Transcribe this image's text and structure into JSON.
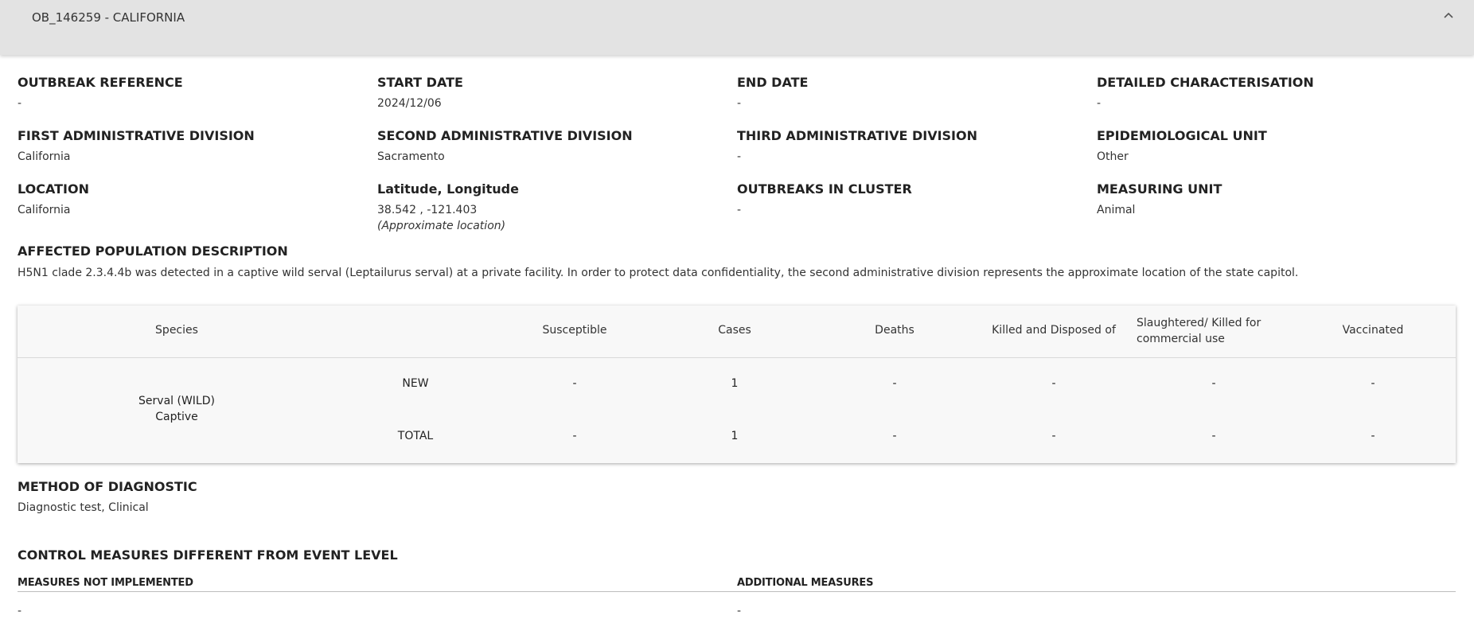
{
  "header": {
    "title": "OB_146259 - CALIFORNIA"
  },
  "fields": {
    "outbreak_reference": {
      "label": "OUTBREAK REFERENCE",
      "value": "-"
    },
    "start_date": {
      "label": "START DATE",
      "value": "2024/12/06"
    },
    "end_date": {
      "label": "END DATE",
      "value": "-"
    },
    "detailed_characterisation": {
      "label": "DETAILED CHARACTERISATION",
      "value": "-"
    },
    "first_admin_division": {
      "label": "FIRST ADMINISTRATIVE DIVISION",
      "value": "California"
    },
    "second_admin_division": {
      "label": "SECOND ADMINISTRATIVE DIVISION",
      "value": "Sacramento"
    },
    "third_admin_division": {
      "label": "THIRD ADMINISTRATIVE DIVISION",
      "value": "-"
    },
    "epidemiological_unit": {
      "label": "EPIDEMIOLOGICAL UNIT",
      "value": "Other"
    },
    "location": {
      "label": "LOCATION",
      "value": "California"
    },
    "lat_long": {
      "label": "Latitude, Longitude",
      "value": "38.542 , -121.403",
      "note": "(Approximate location)"
    },
    "outbreaks_in_cluster": {
      "label": "OUTBREAKS IN CLUSTER",
      "value": "-"
    },
    "measuring_unit": {
      "label": "MEASURING UNIT",
      "value": "Animal"
    }
  },
  "affected_population": {
    "label": "AFFECTED POPULATION DESCRIPTION",
    "text": "H5N1 clade 2.3.4.4b was detected in a captive wild serval (Leptailurus serval) at a private facility. In order to protect data confidentiality, the second administrative division represents the approximate location of the state capitol."
  },
  "table": {
    "headers": {
      "species": "Species",
      "susceptible": "Susceptible",
      "cases": "Cases",
      "deaths": "Deaths",
      "killed_disposed": "Killed and Disposed of",
      "slaughtered": "Slaughtered/ Killed for commercial use",
      "vaccinated": "Vaccinated"
    },
    "species_line1": "Serval (WILD)",
    "species_line2": "Captive",
    "rows": [
      {
        "type": "NEW",
        "susceptible": "-",
        "cases": "1",
        "deaths": "-",
        "killed_disposed": "-",
        "slaughtered": "-",
        "vaccinated": "-"
      },
      {
        "type": "TOTAL",
        "susceptible": "-",
        "cases": "1",
        "deaths": "-",
        "killed_disposed": "-",
        "slaughtered": "-",
        "vaccinated": "-"
      }
    ]
  },
  "method_of_diagnostic": {
    "label": "METHOD OF DIAGNOSTIC",
    "value": "Diagnostic test, Clinical"
  },
  "control_measures": {
    "label": "CONTROL MEASURES DIFFERENT FROM EVENT LEVEL",
    "not_implemented_label": "MEASURES NOT IMPLEMENTED",
    "not_implemented_value": "-",
    "additional_label": "ADDITIONAL MEASURES",
    "additional_value": "-"
  },
  "icons": {
    "collapse": "chevron-up-icon"
  }
}
